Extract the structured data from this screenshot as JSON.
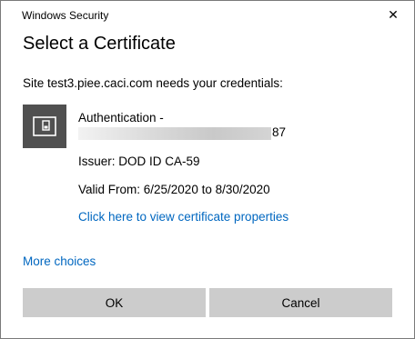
{
  "window": {
    "title": "Windows Security",
    "close_glyph": "✕"
  },
  "heading": "Select a Certificate",
  "site_message": "Site test3.piee.caci.com needs your credentials:",
  "certificate": {
    "icon": "certificate-card-icon",
    "name": "Authentication -",
    "id_suffix": "87",
    "issuer": "Issuer: DOD ID CA-59",
    "valid": "Valid From: 6/25/2020 to 8/30/2020",
    "properties_link": "Click here to view certificate properties"
  },
  "more_choices": "More choices",
  "buttons": {
    "ok": "OK",
    "cancel": "Cancel"
  },
  "colors": {
    "link": "#0067c0",
    "button_bg": "#cccccc",
    "icon_bg": "#505050"
  }
}
